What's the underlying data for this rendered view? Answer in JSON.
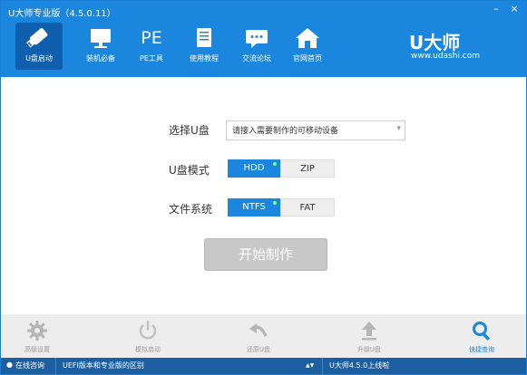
{
  "window": {
    "title": "U大师专业版（4.5.0.11）",
    "controls": {
      "minimize": "–",
      "close": "×"
    }
  },
  "nav": {
    "items": [
      {
        "label": "U盘启动",
        "icon": "usb-drive-icon"
      },
      {
        "label": "装机必备",
        "icon": "monitor-icon"
      },
      {
        "label": "PE工具",
        "icon": "pe-text-icon",
        "glyph": "PE"
      },
      {
        "label": "使用教程",
        "icon": "book-icon"
      },
      {
        "label": "交流论坛",
        "icon": "chat-bubble-icon"
      },
      {
        "label": "官网首页",
        "icon": "home-icon"
      }
    ],
    "active_index": 0
  },
  "brand": {
    "logo": "U大师",
    "url": "www.udashi.com"
  },
  "form": {
    "usb_label": "选择U盘",
    "usb_select_value": "请接入需要制作的可移动设备",
    "mode_label": "U盘模式",
    "mode_options": [
      "HDD",
      "ZIP"
    ],
    "mode_selected": "HDD",
    "fs_label": "文件系统",
    "fs_options": [
      "NTFS",
      "FAT"
    ],
    "fs_selected": "NTFS",
    "start_button": "开始制作"
  },
  "bottom_tools": [
    {
      "label": "高级设置",
      "icon": "gear-icon"
    },
    {
      "label": "模拟启动",
      "icon": "power-icon"
    },
    {
      "label": "还原U盘",
      "icon": "undo-arrow-icon"
    },
    {
      "label": "升级U盘",
      "icon": "upload-arrow-icon"
    },
    {
      "label": "快捷查询",
      "icon": "magnifier-icon"
    }
  ],
  "statusbar": {
    "online": "在线咨询",
    "news": "UEFI版本和专业版的区别",
    "version_notice": "U大师4.5.0上线啦",
    "scroll_arrows": "▲▼"
  },
  "colors": {
    "primary": "#1b86de",
    "active_nav": "#0f5fae",
    "status": "#1b5fa0",
    "disabled": "#c8c8c8"
  }
}
